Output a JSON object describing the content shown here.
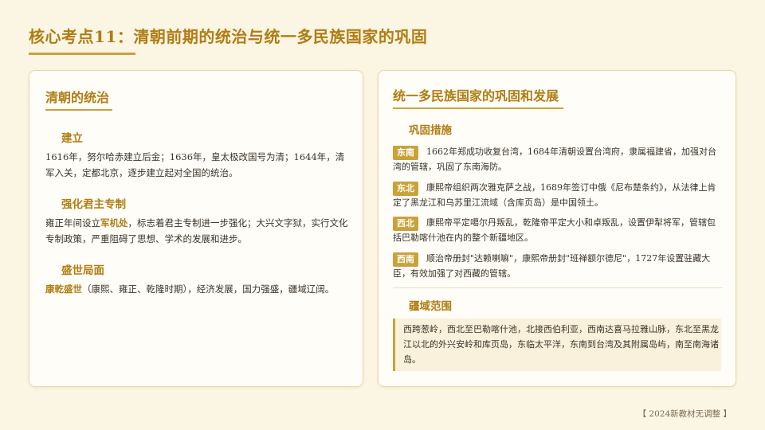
{
  "page": {
    "title": "核心考点11：清朝前期的统治与统一多民族国家的巩固",
    "footer": "【 2024新教材无调整 】"
  },
  "left_panel": {
    "title": "清朝的统治",
    "sections": [
      {
        "heading": "建立",
        "text": "1616年，努尔哈赤建立后金；1636年，皇太极改国号为清；1644年，清军入关，定都北京，逐步建立起对全国的统治。"
      },
      {
        "heading": "强化君主专制",
        "text_before": "雍正年间设立",
        "highlight": "军机处",
        "text_after": "，标志着君主专制进一步强化；大兴文字狱，实行文化专制政策，严重阻碍了思想、学术的发展和进步。"
      },
      {
        "heading": "盛世局面",
        "highlight": "康乾盛世",
        "text_after": "（康熙、雍正、乾隆时期），经济发展，国力强盛，疆域辽阔。"
      }
    ]
  },
  "right_panel": {
    "title": "统一多民族国家的巩固和发展",
    "measures_heading": "巩固措施",
    "measures": [
      {
        "region": "东南",
        "text": "1662年郑成功收复台湾，1684年清朝设置台湾府，隶属福建省，加强对台湾的管辖，巩固了东南海防。"
      },
      {
        "region": "东北",
        "text": "康熙帝组织两次雅克萨之战，1689年签订中俄《尼布楚条约》，从法律上肯定了黑龙江和乌苏里江流域（含库页岛）是中国领土。"
      },
      {
        "region": "西北",
        "text": "康熙帝平定噶尔丹叛乱，乾隆帝平定大小和卓叛乱，设置伊犁将军，管辖包括巴勒喀什池在内的整个新疆地区。"
      },
      {
        "region": "西南",
        "text": "顺治帝册封\"达赖喇嘛\"，康熙帝册封\"班禅额尔德尼\"，1727年设置驻藏大臣，有效加强了对西藏的管辖。"
      }
    ],
    "scope_heading": "疆域范围",
    "scope_text": "西跨葱岭，西北至巴勒喀什池，北接西伯利亚，西南达喜马拉雅山脉，东北至黑龙江以北的外兴安岭和库页岛，东临太平洋，东南到台湾及其附属岛屿，南至南海诸岛。"
  }
}
